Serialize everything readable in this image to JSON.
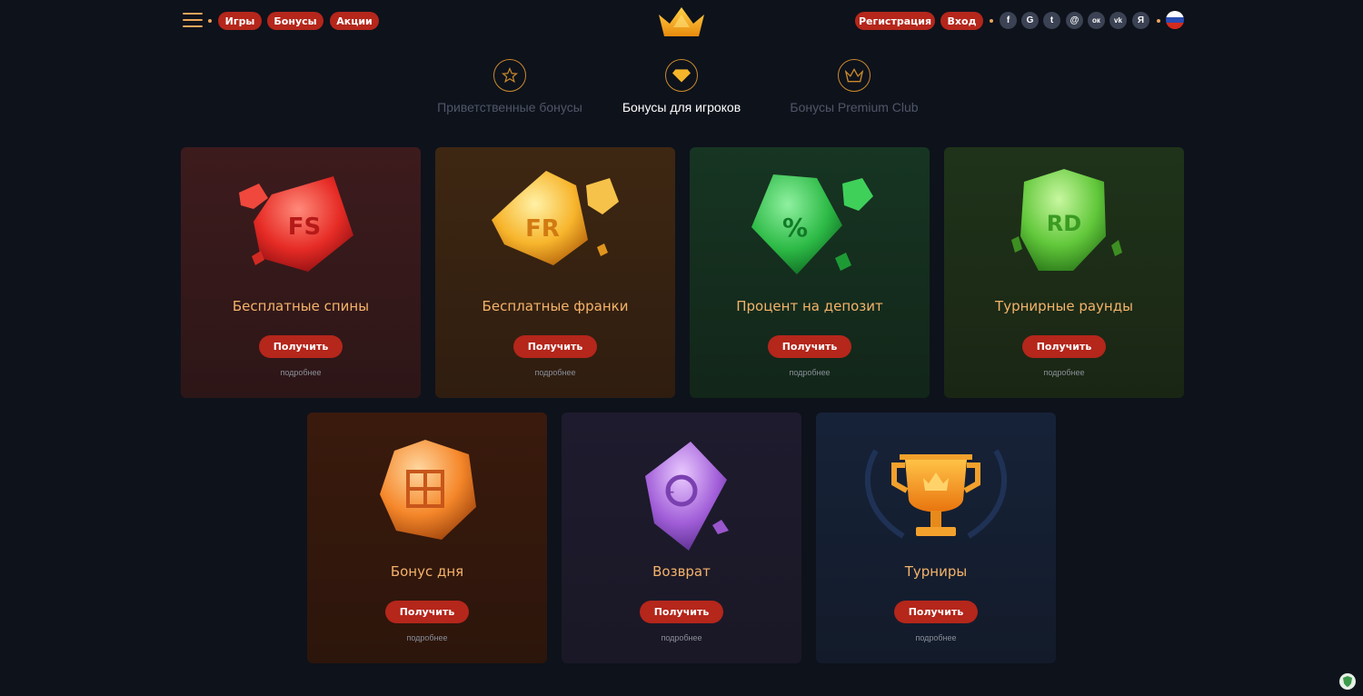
{
  "header": {
    "nav": [
      "Игры",
      "Бонусы",
      "Акции"
    ],
    "register_label": "Регистрация",
    "login_label": "Вход",
    "social": [
      {
        "icon": "facebook-icon",
        "glyph": "f"
      },
      {
        "icon": "google-icon",
        "glyph": "G"
      },
      {
        "icon": "twitter-icon",
        "glyph": "t"
      },
      {
        "icon": "mail-icon",
        "glyph": "@"
      },
      {
        "icon": "odnoklassniki-icon",
        "glyph": "ок"
      },
      {
        "icon": "vk-icon",
        "glyph": "vk"
      },
      {
        "icon": "yandex-icon",
        "glyph": "Я"
      }
    ],
    "language_icon": "russia-flag-icon"
  },
  "tabs": [
    {
      "label": "Приветственные бонусы",
      "icon": "star-icon"
    },
    {
      "label": "Бонусы для игроков",
      "icon": "diamond-icon",
      "active": true
    },
    {
      "label": "Бонусы Premium Club",
      "icon": "crown-icon"
    }
  ],
  "cards": [
    {
      "title": "Бесплатные спины",
      "gem_text": "FS",
      "button": "Получить",
      "more": "подробнее"
    },
    {
      "title": "Бесплатные франки",
      "gem_text": "FR",
      "button": "Получить",
      "more": "подробнее"
    },
    {
      "title": "Процент на депозит",
      "gem_text": "%",
      "button": "Получить",
      "more": "подробнее"
    },
    {
      "title": "Турнирные раунды",
      "gem_text": "RD",
      "button": "Получить",
      "more": "подробнее"
    },
    {
      "title": "Бонус дня",
      "gem_text": "",
      "button": "Получить",
      "more": "подробнее"
    },
    {
      "title": "Возврат",
      "gem_text": "",
      "button": "Получить",
      "more": "подробнее"
    },
    {
      "title": "Турниры",
      "gem_text": "",
      "button": "Получить",
      "more": "подробнее"
    }
  ],
  "colors": {
    "background": "#0e121b",
    "accent_button": "#b5261b",
    "title_text": "#f4b36a",
    "card_red": "#3a1a1c",
    "card_amber": "#3b2412",
    "card_green": "#15301f",
    "card_olive": "#1f2e16",
    "card_orange": "#35180c",
    "card_purple": "#1c1a2c",
    "card_blue": "#141e30"
  }
}
